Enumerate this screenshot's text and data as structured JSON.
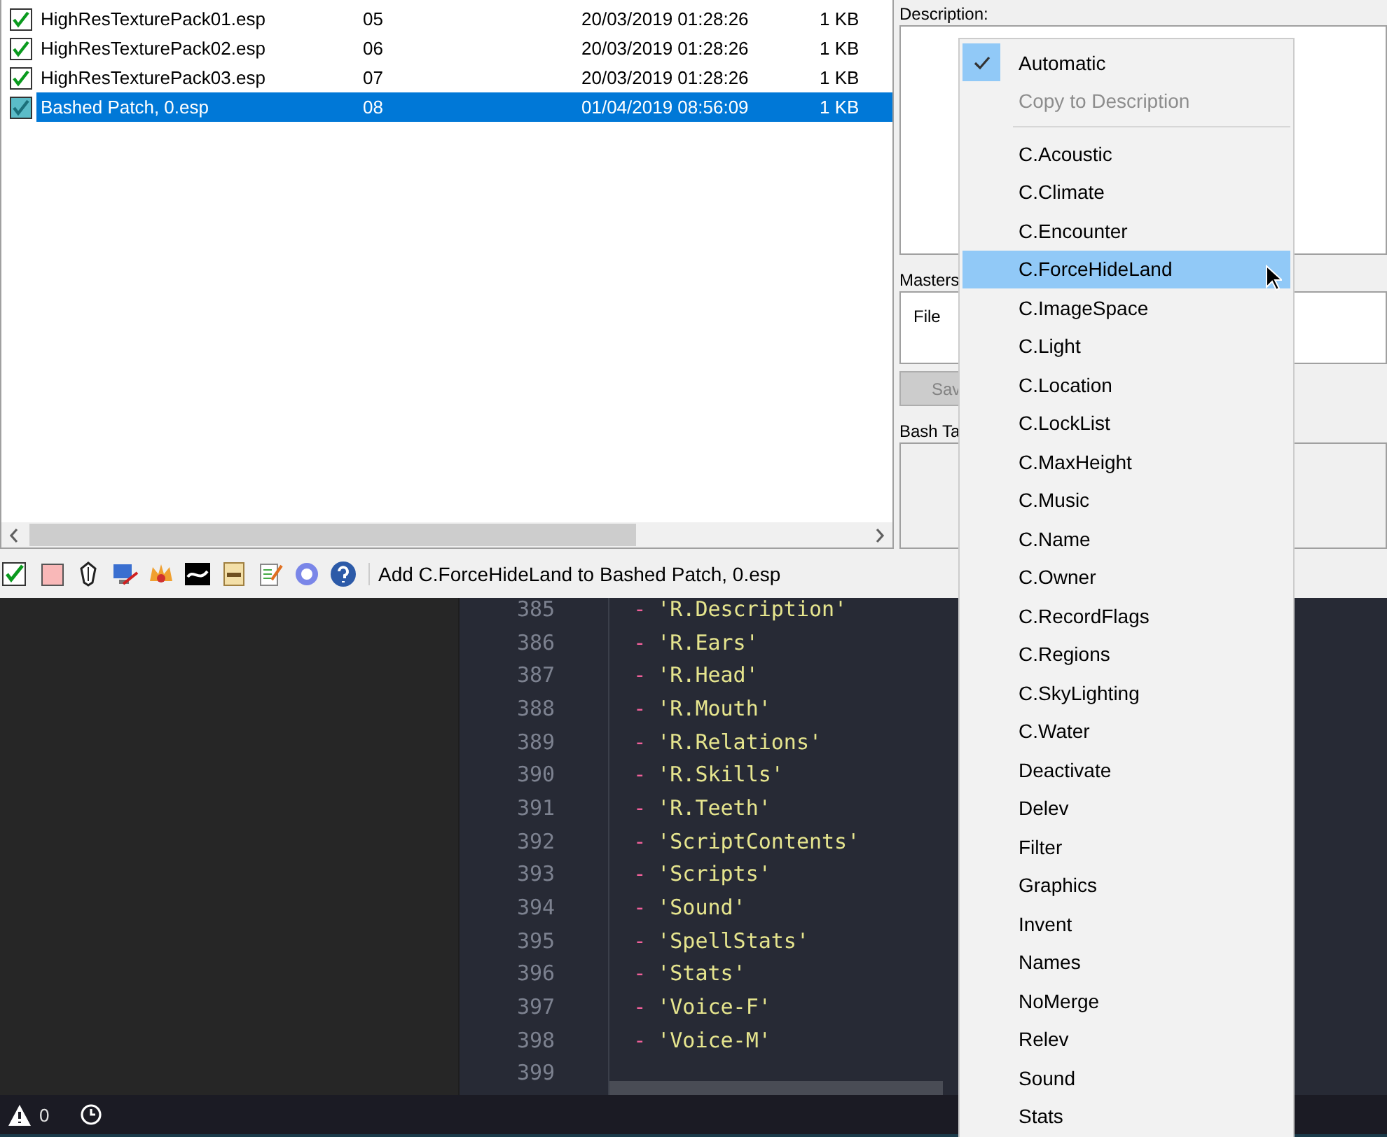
{
  "plugins": [
    {
      "name": "HighResTexturePack01.esp",
      "order": "05",
      "modified": "20/03/2019 01:28:26",
      "size": "1 KB",
      "checked": true,
      "selected": false
    },
    {
      "name": "HighResTexturePack02.esp",
      "order": "06",
      "modified": "20/03/2019 01:28:26",
      "size": "1 KB",
      "checked": true,
      "selected": false
    },
    {
      "name": "HighResTexturePack03.esp",
      "order": "07",
      "modified": "20/03/2019 01:28:26",
      "size": "1 KB",
      "checked": true,
      "selected": false
    },
    {
      "name": "Bashed Patch, 0.esp",
      "order": "08",
      "modified": "01/04/2019 08:56:09",
      "size": "1 KB",
      "checked": true,
      "selected": true
    }
  ],
  "details": {
    "description_label": "Description:",
    "masters_label": "Masters",
    "masters_column": "File",
    "save_button": "Sav",
    "bash_tags_label": "Bash Ta"
  },
  "toolbar": {
    "status_text": "Add C.ForceHideLand to Bashed Patch, 0.esp"
  },
  "editor": {
    "lines": [
      {
        "number": "385",
        "marker": "-",
        "text": "'R.Description'"
      },
      {
        "number": "386",
        "marker": "-",
        "text": "'R.Ears'"
      },
      {
        "number": "387",
        "marker": "-",
        "text": "'R.Head'"
      },
      {
        "number": "388",
        "marker": "-",
        "text": "'R.Mouth'"
      },
      {
        "number": "389",
        "marker": "-",
        "text": "'R.Relations'"
      },
      {
        "number": "390",
        "marker": "-",
        "text": "'R.Skills'"
      },
      {
        "number": "391",
        "marker": "-",
        "text": "'R.Teeth'"
      },
      {
        "number": "392",
        "marker": "-",
        "text": "'ScriptContents'"
      },
      {
        "number": "393",
        "marker": "-",
        "text": "'Scripts'"
      },
      {
        "number": "394",
        "marker": "-",
        "text": "'Sound'"
      },
      {
        "number": "395",
        "marker": "-",
        "text": "'SpellStats'"
      },
      {
        "number": "396",
        "marker": "-",
        "text": "'Stats'"
      },
      {
        "number": "397",
        "marker": "-",
        "text": "'Voice-F'"
      },
      {
        "number": "398",
        "marker": "-",
        "text": "'Voice-M'"
      },
      {
        "number": "399"
      }
    ]
  },
  "status_bar": {
    "warnings": "0"
  },
  "menu": {
    "items": [
      {
        "kind": "check",
        "label": "Automatic",
        "checked": true,
        "disabled": false,
        "selected": false
      },
      {
        "kind": "action",
        "label": "Copy to Description",
        "disabled": true,
        "selected": false
      },
      {
        "kind": "separator"
      },
      {
        "kind": "item",
        "label": "C.Acoustic",
        "selected": false
      },
      {
        "kind": "item",
        "label": "C.Climate",
        "selected": false
      },
      {
        "kind": "item",
        "label": "C.Encounter",
        "selected": false
      },
      {
        "kind": "item",
        "label": "C.ForceHideLand",
        "selected": true
      },
      {
        "kind": "item",
        "label": "C.ImageSpace",
        "selected": false
      },
      {
        "kind": "item",
        "label": "C.Light",
        "selected": false
      },
      {
        "kind": "item",
        "label": "C.Location",
        "selected": false
      },
      {
        "kind": "item",
        "label": "C.LockList",
        "selected": false
      },
      {
        "kind": "item",
        "label": "C.MaxHeight",
        "selected": false
      },
      {
        "kind": "item",
        "label": "C.Music",
        "selected": false
      },
      {
        "kind": "item",
        "label": "C.Name",
        "selected": false
      },
      {
        "kind": "item",
        "label": "C.Owner",
        "selected": false
      },
      {
        "kind": "item",
        "label": "C.RecordFlags",
        "selected": false
      },
      {
        "kind": "item",
        "label": "C.Regions",
        "selected": false
      },
      {
        "kind": "item",
        "label": "C.SkyLighting",
        "selected": false
      },
      {
        "kind": "item",
        "label": "C.Water",
        "selected": false
      },
      {
        "kind": "item",
        "label": "Deactivate",
        "selected": false
      },
      {
        "kind": "item",
        "label": "Delev",
        "selected": false
      },
      {
        "kind": "item",
        "label": "Filter",
        "selected": false
      },
      {
        "kind": "item",
        "label": "Graphics",
        "selected": false
      },
      {
        "kind": "item",
        "label": "Invent",
        "selected": false
      },
      {
        "kind": "item",
        "label": "Names",
        "selected": false
      },
      {
        "kind": "item",
        "label": "NoMerge",
        "selected": false
      },
      {
        "kind": "item",
        "label": "Relev",
        "selected": false
      },
      {
        "kind": "item",
        "label": "Sound",
        "selected": false
      },
      {
        "kind": "item",
        "label": "Stats",
        "selected": false
      }
    ]
  }
}
